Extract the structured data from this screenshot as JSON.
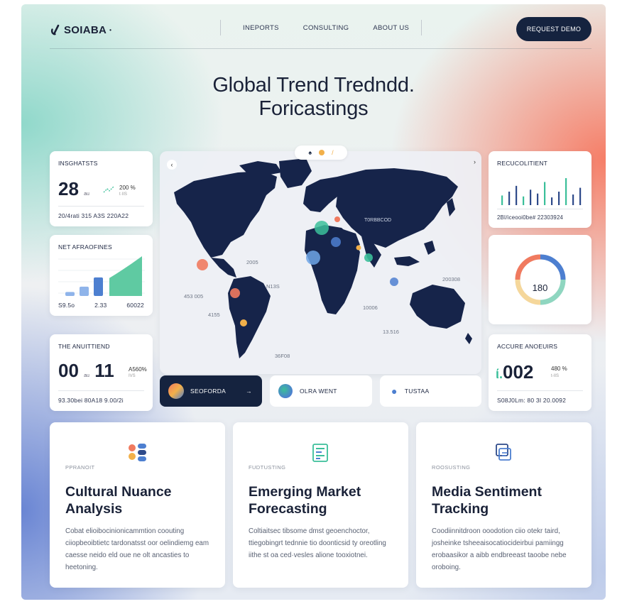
{
  "brand": {
    "name": "SOIABA"
  },
  "nav": {
    "links": [
      "INEPORTS",
      "CONSULTING",
      "ABOUT US"
    ],
    "cta": "REQUEST DEMO"
  },
  "hero": {
    "line1": "Global Trend Tredndd.",
    "line2": "Foricastings"
  },
  "insights": {
    "title": "INSGHATSTS",
    "value": "28",
    "unit": "au",
    "pct": "200 %",
    "sub": "t·IIS",
    "footer": "20/4rati 315 A3S  220A22"
  },
  "metrics": {
    "title": "NET AFRAOFINES",
    "values": [
      6,
      14,
      28,
      60
    ],
    "footer": [
      "S9.5o",
      "2.33",
      "60022"
    ]
  },
  "trend": {
    "title": "THE ANUITTIEND",
    "value1": "00",
    "unit1": "au",
    "value2": "11",
    "pct": "A560%",
    "sub": "IVS",
    "footer": "93.30bei 80A18 9.00/2i"
  },
  "recruitment": {
    "title": "RECUCOLITIENT",
    "values": [
      10,
      14,
      20,
      9,
      16,
      12,
      24,
      8,
      14,
      28,
      11,
      18
    ],
    "footer": "2BI/iceooi0be#  22303924"
  },
  "donut": {
    "value": "180"
  },
  "accuracy": {
    "title": "ACCURE ANOEUIRS",
    "prefix": "ί.",
    "value": "002",
    "pct": "480 %",
    "sub": "t-IIS",
    "footer": "S08J0Lm: 80 3I  20.0092"
  },
  "map": {
    "labels": [
      "2005",
      "N13S",
      "453 005",
      "4155",
      "T0RBBCOD",
      "200308",
      "10006",
      "13.516",
      "36F08"
    ],
    "pills": [
      {
        "label": "SEOFORDA",
        "arrow": "→"
      },
      {
        "label": "OLRA WENT"
      },
      {
        "label": "TUSTAA"
      }
    ]
  },
  "features": [
    {
      "tag": "PPRANOIT",
      "title": "Cultural Nuance Analysis",
      "body": "Cobat elioibocinionicammtion coouting ciiopbeoibtietc tardonatsst oor oelindiemg eam caesse neido eld oue ne olt ancasties to heetoning."
    },
    {
      "tag": "FUDTUSTING",
      "title": "Emerging Market Forecasting",
      "body": "Coltiaitsec tibsome dmst geoenchoctor, ttiegobingrt tednnie tio doonticsid ty oreotling iithe st oa ced·vesles alione tooxiotnei."
    },
    {
      "tag": "ROOSUSTING",
      "title": "Media Sentiment Tracking",
      "body": "Coodiinnitdroon ooodotion ciio otekr taird, josheinke tsheeaisocatiocideirbui pamiingg erobaasikor a aibb endbreeast taoobe nebe oroboing."
    }
  ],
  "colors": {
    "navy": "#15233f",
    "teal": "#3bbf9a",
    "blue": "#4d7fd0",
    "coral": "#f07a5f",
    "amber": "#f2b04a"
  }
}
